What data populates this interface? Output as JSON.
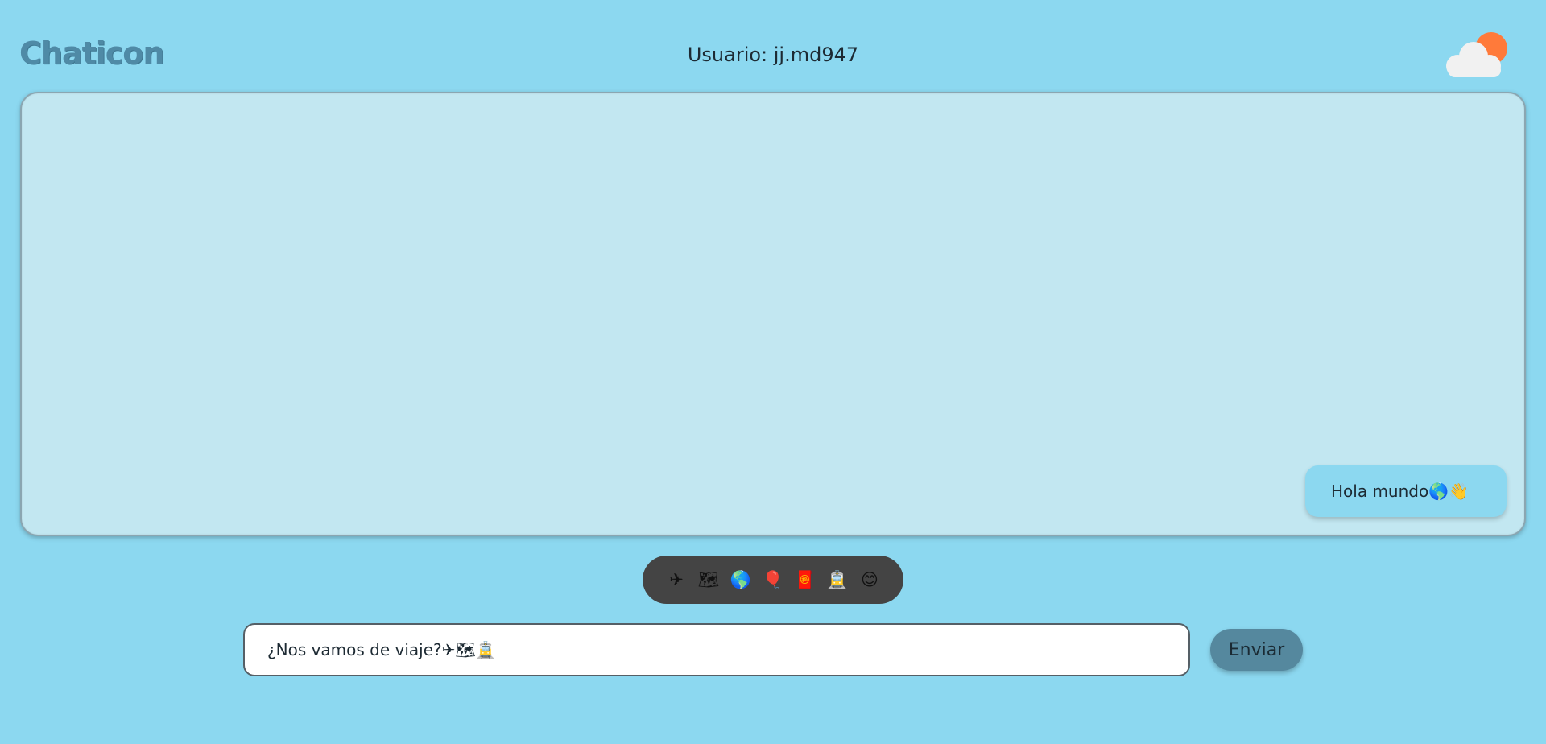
{
  "header": {
    "logo": "Chaticon",
    "user_label": "Usuario: jj.md947",
    "weather_icon": "cloud-sun-icon"
  },
  "chat": {
    "messages": [
      {
        "text": "Hola mundo🌎👋"
      }
    ]
  },
  "emoji_bar": {
    "emojis": [
      "✈",
      "🗺",
      "🌎",
      "🎈",
      "🧧",
      "🚊",
      "😊"
    ]
  },
  "composer": {
    "input_value": "¿Nos vamos de viaje?✈🗺🚊",
    "send_label": "Enviar"
  },
  "colors": {
    "background": "#8cd8f0",
    "panel": "#c2e7f1",
    "send_button": "#55889e",
    "emoji_bar": "#444444",
    "logo": "#4f8aa6"
  }
}
